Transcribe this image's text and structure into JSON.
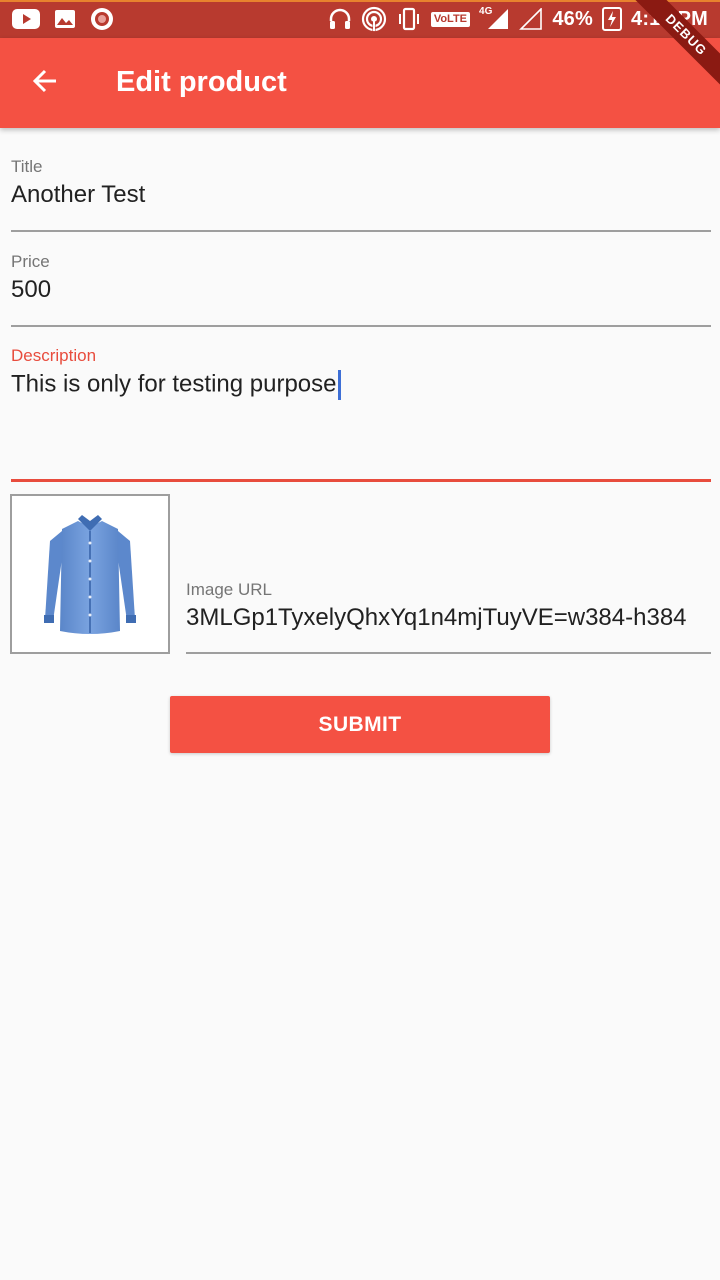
{
  "status_bar": {
    "battery_percent": "46%",
    "time": "4:18 PM",
    "volte_label": "VoLTE",
    "network_label": "4G",
    "left_icons": [
      "youtube-icon",
      "gallery-icon",
      "record-icon"
    ],
    "right_icons": [
      "headphones-icon",
      "hotspot-icon",
      "vibrate-icon",
      "volte-icon",
      "signal-icon",
      "signal-empty-icon",
      "battery-charging-icon"
    ]
  },
  "app_bar": {
    "title": "Edit product",
    "back_icon": "arrow-back-icon",
    "color": "#f45143"
  },
  "debug_banner": {
    "label": "DEBUG"
  },
  "form": {
    "title": {
      "label": "Title",
      "value": "Another Test"
    },
    "price": {
      "label": "Price",
      "value": "500"
    },
    "description": {
      "label": "Description",
      "value": "This is only for testing purpose"
    },
    "image_url": {
      "label": "Image URL",
      "value": "3MLGp1TyxelyQhxYq1n4mjTuyVE=w384-h384"
    }
  },
  "image_preview": {
    "icon": "shirt-image"
  },
  "submit": {
    "label": "SUBMIT"
  },
  "colors": {
    "primary": "#f45143",
    "status_bar": "#b83a2f",
    "focus": "#e84c3d",
    "cursor": "#3d6fd6"
  }
}
